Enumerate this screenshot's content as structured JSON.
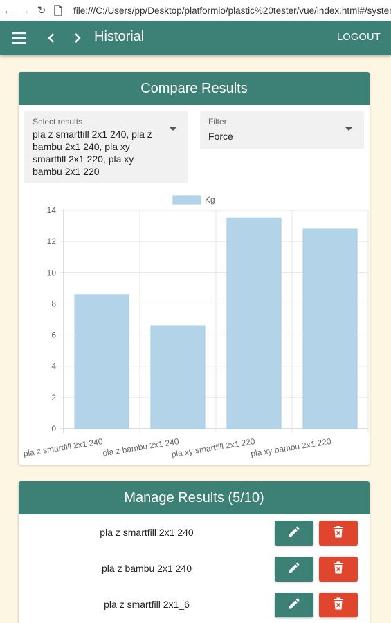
{
  "browser": {
    "url": "file:///C:/Users/pp/Desktop/platformio/plastic%20tester/vue/index.html#/syster"
  },
  "appbar": {
    "title": "Historial",
    "logout_label": "LOGOUT"
  },
  "compare": {
    "title": "Compare Results",
    "select_results": {
      "label": "Select results",
      "value": "pla z smartfill 2x1 240, pla z bambu 2x1 240, pla xy smartfill 2x1 220, pla xy bambu 2x1 220"
    },
    "filter": {
      "label": "Filter",
      "value": "Force"
    }
  },
  "chart_data": {
    "type": "bar",
    "categories": [
      "pla z smartfill 2x1 240",
      "pla z bambu 2x1 240",
      "pla xy smartfill 2x1 220",
      "pla xy bambu 2x1 220"
    ],
    "series": [
      {
        "name": "Kg",
        "values": [
          8.6,
          6.6,
          13.5,
          12.8
        ]
      }
    ],
    "ylim": [
      0,
      14
    ],
    "yticks": [
      0,
      2,
      4,
      6,
      8,
      10,
      12,
      14
    ],
    "legend": "top",
    "grid": true,
    "bar_color": "#b3d4e8",
    "bar_border": "#a5cbe2"
  },
  "manage": {
    "title": "Manage Results (5/10)",
    "items": [
      {
        "name": "pla z smartfill 2x1 240"
      },
      {
        "name": "pla z bambu 2x1 240"
      },
      {
        "name": "pla z smartfill 2x1_6"
      }
    ]
  },
  "colors": {
    "primary": "#3d8075",
    "danger": "#e0452d",
    "background": "#fdf6e3"
  }
}
